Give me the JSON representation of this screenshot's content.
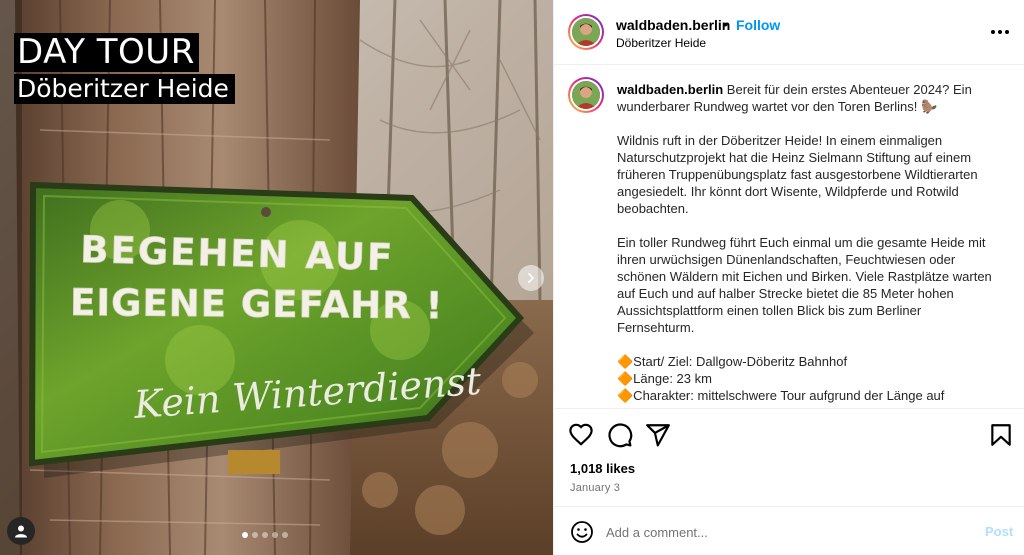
{
  "post_media": {
    "overlay_title": "DAY TOUR",
    "overlay_subtitle": "Döberitzer Heide",
    "sign_lines": [
      "BEGEHEN AUF",
      "EIGENE GEFAHR !",
      "Kein Winterdienst"
    ],
    "carousel_dots": 5,
    "active_dot": 0
  },
  "header": {
    "username": "waldbaden.berlin",
    "separator": "•",
    "follow_label": "Follow",
    "location": "Döberitzer Heide"
  },
  "caption": {
    "username": "waldbaden.berlin",
    "text": " Bereit für dein erstes Abenteuer 2024? Ein wunderbarer Rundweg wartet vor den Toren Berlins! 🦫\n\nWildnis ruft in der Döberitzer Heide! In einem einmaligen Naturschutzprojekt hat die Heinz Sielmann Stiftung auf einem früheren Truppenübungsplatz fast ausgestorbene Wildtierarten angesiedelt. Ihr könnt dort Wisente, Wildpferde und Rotwild beobachten.\n\nEin toller Rundweg führt Euch einmal um die gesamte Heide mit ihren urwüchsigen Dünenlandschaften, Feuchtwiesen oder schönen Wäldern mit Eichen und Birken. Viele Rastplätze warten auf Euch und auf halber Strecke bietet die 85 Meter hohen Aussichtsplattform einen tollen Blick bis zum Berliner Fernsehturm.\n\n🔶Start/ Ziel: Dallgow-Döberitz Bahnhof\n🔶Länge: 23 km\n🔶Charakter: mittelschwere Tour aufgrund der Länge auf"
  },
  "engagement": {
    "likes": "1,018 likes",
    "date": "January 3"
  },
  "comment_bar": {
    "placeholder": "Add a comment...",
    "post_label": "Post"
  },
  "colors": {
    "accent_blue": "#0095f6",
    "post_disabled": "#b2dffc",
    "sign_green": "#5f9a2a"
  },
  "icons": [
    "user-tag-icon",
    "next-arrow-icon",
    "more-options-icon",
    "heart-icon",
    "comment-icon",
    "share-icon",
    "bookmark-icon",
    "emoji-icon"
  ]
}
